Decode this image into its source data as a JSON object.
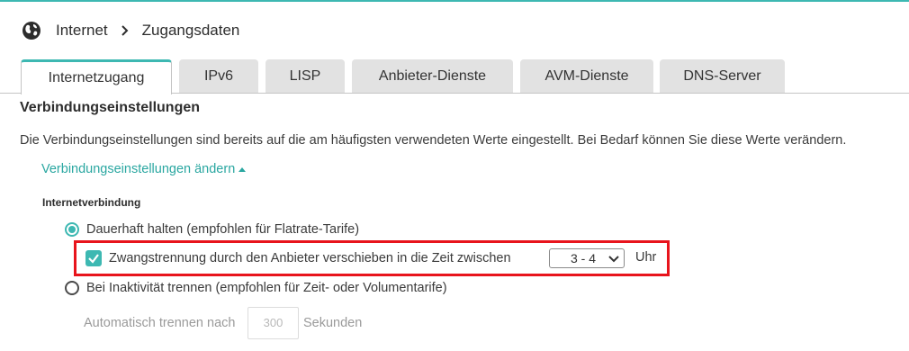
{
  "breadcrumb": {
    "root": "Internet",
    "current": "Zugangsdaten"
  },
  "tabs": [
    {
      "label": "Internetzugang",
      "active": true
    },
    {
      "label": "IPv6",
      "active": false
    },
    {
      "label": "LISP",
      "active": false
    },
    {
      "label": "Anbieter-Dienste",
      "active": false
    },
    {
      "label": "AVM-Dienste",
      "active": false
    },
    {
      "label": "DNS-Server",
      "active": false
    }
  ],
  "section": {
    "title": "Verbindungseinstellungen",
    "description": "Die Verbindungseinstellungen sind bereits auf die am häufigsten verwendeten Werte eingestellt. Bei Bedarf können Sie diese Werte verändern.",
    "toggle_link": "Verbindungseinstellungen ändern"
  },
  "internet": {
    "heading": "Internetverbindung",
    "option_permanent": {
      "label": "Dauerhaft halten (empfohlen für Flatrate-Tarife)",
      "checked": true
    },
    "forced_disconnect": {
      "label": "Zwangstrennung durch den Anbieter verschieben in die Zeit zwischen",
      "checked": true,
      "time_value": "3 - 4",
      "unit": "Uhr"
    },
    "option_inactivity": {
      "label": "Bei Inaktivität trennen (empfohlen für Zeit- oder Volumentarife)",
      "checked": false
    },
    "auto_disconnect": {
      "label": "Automatisch trennen nach",
      "value": "300",
      "unit": "Sekunden"
    }
  },
  "colors": {
    "accent": "#3db8b2",
    "highlight": "#e8141c",
    "link": "#2aa7a1"
  },
  "icons": {
    "breadcrumb": "globe-icon",
    "separator": "chevron-right-icon",
    "toggle": "caret-up-icon",
    "select": "chevron-down-icon"
  }
}
